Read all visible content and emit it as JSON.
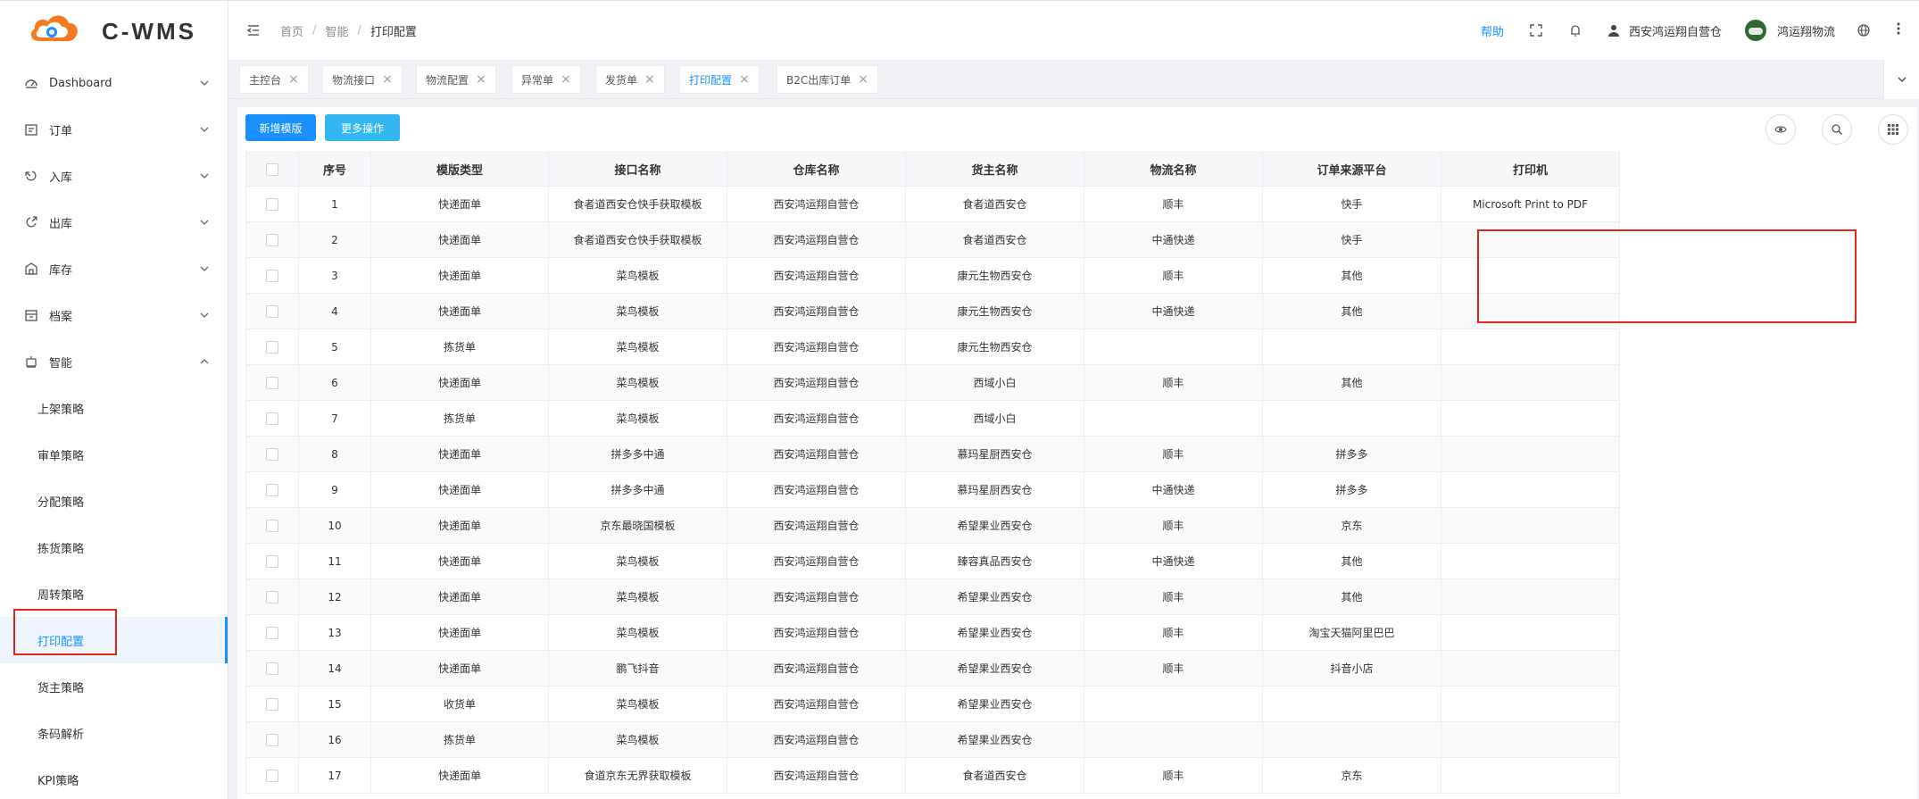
{
  "logo": {
    "text": "C-WMS"
  },
  "sidebar": {
    "items": [
      {
        "label": "Dashboard",
        "icon": "dashboard-icon"
      },
      {
        "label": "订单",
        "icon": "order-icon"
      },
      {
        "label": "入库",
        "icon": "inbound-icon"
      },
      {
        "label": "出库",
        "icon": "outbound-icon"
      },
      {
        "label": "库存",
        "icon": "inventory-icon"
      },
      {
        "label": "档案",
        "icon": "archive-icon"
      },
      {
        "label": "智能",
        "icon": "smart-icon"
      }
    ],
    "sub_items": [
      "上架策略",
      "审单策略",
      "分配策略",
      "拣货策略",
      "周转策略",
      "打印配置",
      "货主策略",
      "条码解析",
      "KPI策略"
    ]
  },
  "header": {
    "breadcrumb": [
      "首页",
      "智能",
      "打印配置"
    ],
    "help": "帮助",
    "user": "西安鸿运翔自营仓",
    "org": "鸿运翔物流"
  },
  "tabs": [
    "主控台",
    "物流接口",
    "物流配置",
    "异常单",
    "发货单",
    "打印配置",
    "B2C出库订单"
  ],
  "toolbar": {
    "add_label": "新增模版",
    "more_label": "更多操作"
  },
  "table": {
    "headers": [
      "序号",
      "模版类型",
      "接口名称",
      "仓库名称",
      "货主名称",
      "物流名称",
      "订单来源平台",
      "打印机"
    ],
    "rows": [
      [
        "1",
        "快递面单",
        "食者道西安仓快手获取模板",
        "西安鸿运翔自营仓",
        "食者道西安仓",
        "顺丰",
        "快手",
        "Microsoft Print to PDF"
      ],
      [
        "2",
        "快递面单",
        "食者道西安仓快手获取模板",
        "西安鸿运翔自营仓",
        "食者道西安仓",
        "中通快递",
        "快手",
        ""
      ],
      [
        "3",
        "快递面单",
        "菜鸟模板",
        "西安鸿运翔自营仓",
        "康元生物西安仓",
        "顺丰",
        "其他",
        ""
      ],
      [
        "4",
        "快递面单",
        "菜鸟模板",
        "西安鸿运翔自营仓",
        "康元生物西安仓",
        "中通快递",
        "其他",
        ""
      ],
      [
        "5",
        "拣货单",
        "菜鸟模板",
        "西安鸿运翔自营仓",
        "康元生物西安仓",
        "",
        "",
        ""
      ],
      [
        "6",
        "快递面单",
        "菜鸟模板",
        "西安鸿运翔自营仓",
        "西域小白",
        "顺丰",
        "其他",
        ""
      ],
      [
        "7",
        "拣货单",
        "菜鸟模板",
        "西安鸿运翔自营仓",
        "西域小白",
        "",
        "",
        ""
      ],
      [
        "8",
        "快递面单",
        "拼多多中通",
        "西安鸿运翔自营仓",
        "慕玛星厨西安仓",
        "顺丰",
        "拼多多",
        ""
      ],
      [
        "9",
        "快递面单",
        "拼多多中通",
        "西安鸿运翔自营仓",
        "慕玛星厨西安仓",
        "中通快递",
        "拼多多",
        ""
      ],
      [
        "10",
        "快递面单",
        "京东最晓国模板",
        "西安鸿运翔自营仓",
        "希望果业西安仓",
        "顺丰",
        "京东",
        ""
      ],
      [
        "11",
        "快递面单",
        "菜鸟模板",
        "西安鸿运翔自营仓",
        "臻容真品西安仓",
        "中通快递",
        "其他",
        ""
      ],
      [
        "12",
        "快递面单",
        "菜鸟模板",
        "西安鸿运翔自营仓",
        "希望果业西安仓",
        "顺丰",
        "其他",
        ""
      ],
      [
        "13",
        "快递面单",
        "菜鸟模板",
        "西安鸿运翔自营仓",
        "希望果业西安仓",
        "顺丰",
        "淘宝天猫阿里巴巴",
        ""
      ],
      [
        "14",
        "快递面单",
        "鹏飞抖音",
        "西安鸿运翔自营仓",
        "希望果业西安仓",
        "顺丰",
        "抖音小店",
        ""
      ],
      [
        "15",
        "收货单",
        "菜鸟模板",
        "西安鸿运翔自营仓",
        "希望果业西安仓",
        "",
        "",
        ""
      ],
      [
        "16",
        "拣货单",
        "菜鸟模板",
        "西安鸿运翔自营仓",
        "希望果业西安仓",
        "",
        "",
        ""
      ],
      [
        "17",
        "快递面单",
        "食道京东无界获取模板",
        "西安鸿运翔自营仓",
        "食者道西安仓",
        "顺丰",
        "京东",
        ""
      ]
    ]
  },
  "colors": {
    "primary": "#1890ff",
    "highlight": "#e1251b",
    "logo_orange": "#f47b20"
  }
}
